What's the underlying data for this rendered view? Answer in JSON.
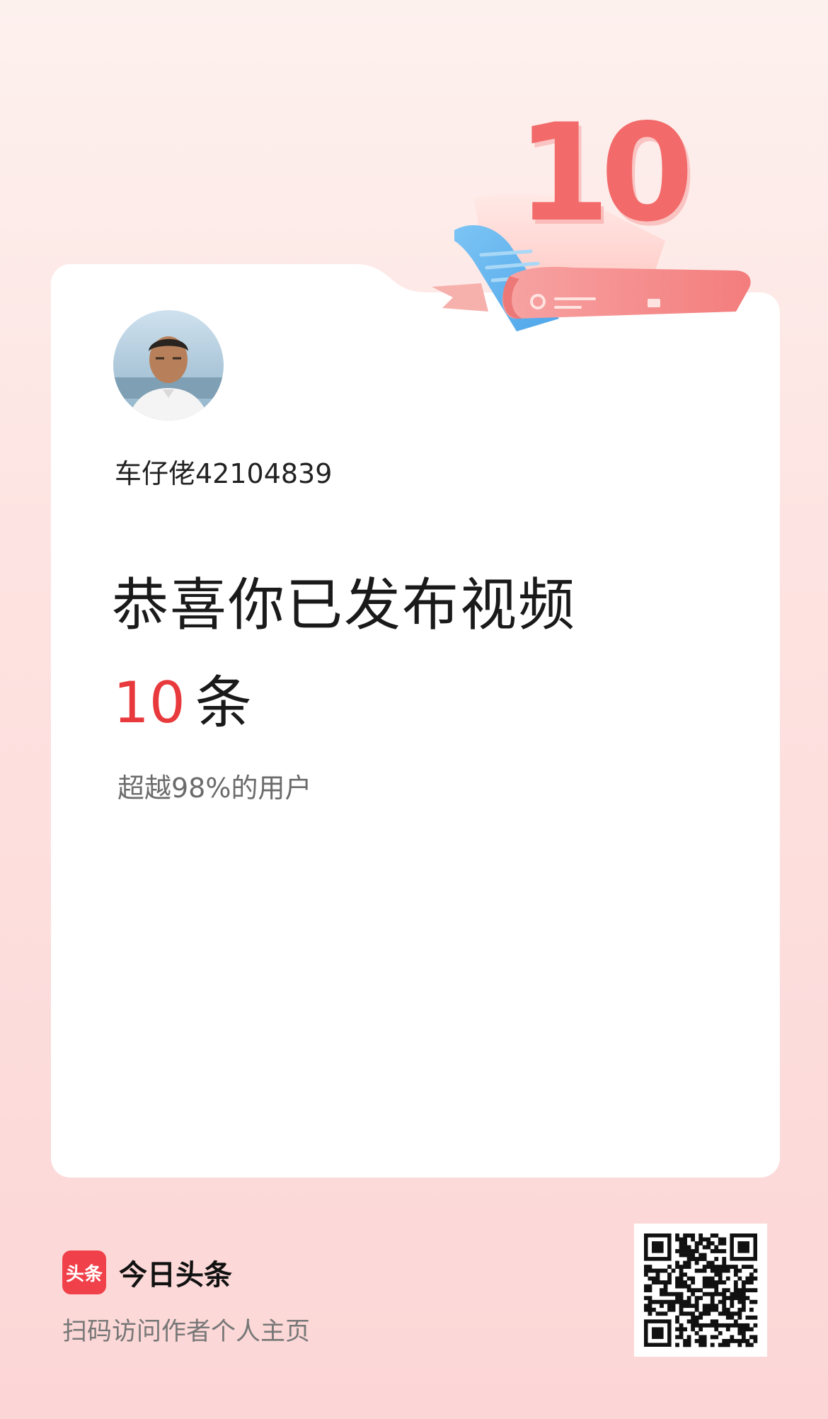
{
  "card": {
    "username": "车仔佬42104839",
    "headline": "恭喜你已发布视频",
    "count_value": "10",
    "count_unit": "条",
    "subtext": "超越98%的用户"
  },
  "badge": {
    "number": "10"
  },
  "footer": {
    "brand_logo_text": "头条",
    "brand_name": "今日头条",
    "scan_hint": "扫码访问作者个人主页"
  },
  "colors": {
    "accent": "#e8393c",
    "brand_red": "#f0414a",
    "badge_pink": "#f26a6a",
    "ribbon_blue": "#6ab8f0"
  }
}
